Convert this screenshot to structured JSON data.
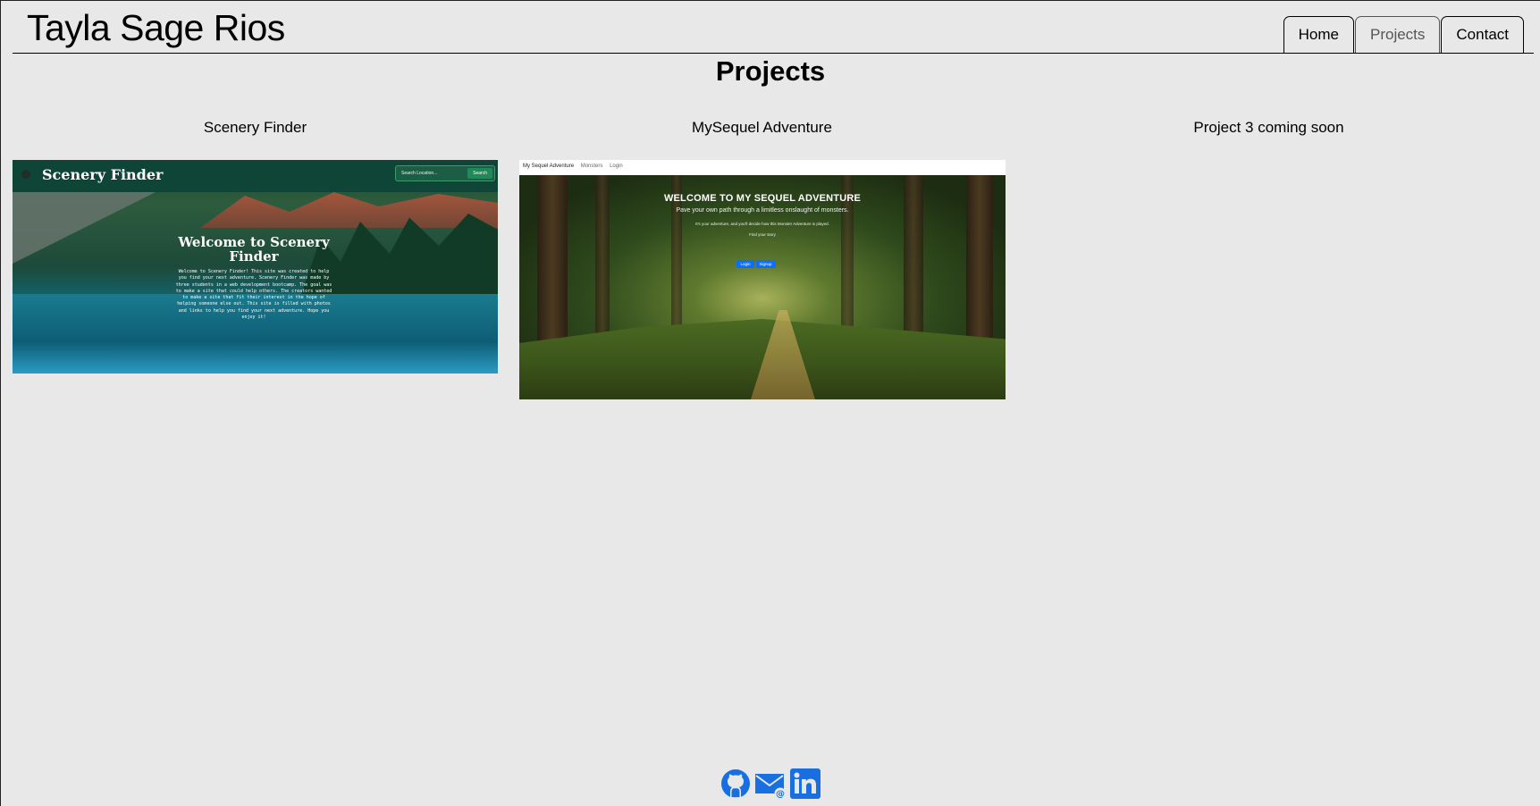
{
  "header": {
    "site_title": "Tayla Sage Rios",
    "nav": [
      {
        "label": "Home",
        "active": false
      },
      {
        "label": "Projects",
        "active": true
      },
      {
        "label": "Contact",
        "active": false
      }
    ]
  },
  "main": {
    "page_title": "Projects",
    "projects": [
      {
        "name": "Scenery Finder",
        "screenshot": {
          "logo": "Scenery Finder",
          "search_placeholder": "Search Location...",
          "search_button": "Search",
          "heading": "Welcome to Scenery Finder",
          "body": "Welcome to Scenery Finder! This site was created to help you find your next adventure. Scenery Finder was made by three students in a web development bootcamp. The goal was to make a site that could help others. The creators wanted to make a site that fit their interest in the hope of helping someone else out. This site is filled with photos and links to help you find your next adventure. Hope you enjoy it!"
        }
      },
      {
        "name": "MySequel Adventure",
        "screenshot": {
          "nav_brand": "My Sequel Adventure",
          "nav_monsters": "Monsters",
          "nav_login": "Login",
          "heading": "WELCOME TO MY SEQUEL ADVENTURE",
          "subheading": "Pave your own path through a limitless onslaught of monsters.",
          "small_text": "It's your adventure, and you'll decide how this Monster Adventure is played.",
          "tag_text": "Find your story",
          "login_button": "Login",
          "signup_button": "Signup"
        }
      },
      {
        "name": "Project 3 coming soon"
      }
    ]
  },
  "footer": {
    "icons": [
      "github-icon",
      "email-icon",
      "linkedin-icon"
    ],
    "icon_color": "#1a6fe0"
  }
}
